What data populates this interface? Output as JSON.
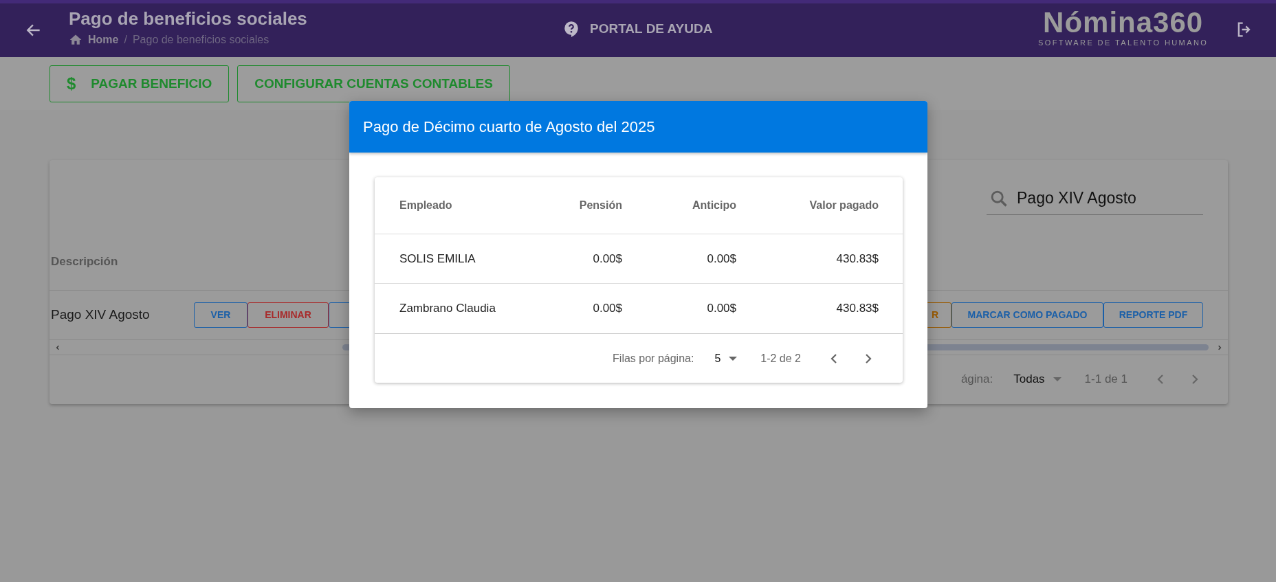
{
  "header": {
    "title": "Pago de beneficios sociales",
    "breadcrumb": [
      {
        "label": "Home",
        "kind": "home"
      },
      {
        "label": "/",
        "kind": "separator"
      },
      {
        "label": "Pago de beneficios sociales",
        "kind": "current"
      }
    ],
    "help_link": "PORTAL DE AYUDA",
    "logo": {
      "name": "Nómina360",
      "tagline": "SOFTWARE DE TALENTO HUMANO"
    }
  },
  "actions": [
    {
      "label": "PAGAR BENEFICIO",
      "kind": "pay",
      "icon": "$"
    },
    {
      "label": "CONFIGURAR CUENTAS CONTABLES",
      "kind": "plain"
    }
  ],
  "benefits_table": {
    "search": {
      "value": "Pago XIV Agosto"
    },
    "columns": [
      "Descripción"
    ],
    "rows": [
      {
        "cells": [
          "Pago XIV Agosto"
        ],
        "buttons": [
          {
            "label": "VER",
            "color": "#1a5fa8",
            "kind": "left"
          },
          {
            "label": "ELIMINAR",
            "color": "#a82a2a",
            "kind": "left"
          },
          {
            "color": "#1a5fa8",
            "kind": "covered"
          },
          {
            "label": "R",
            "color": "#9a5a00",
            "kind": "right"
          },
          {
            "label": "MARCAR COMO PAGADO",
            "color": "#1a5fa8",
            "kind": "right"
          },
          {
            "label": "REPORTE PDF",
            "color": "#1a5fa8",
            "kind": "right"
          }
        ]
      }
    ],
    "footer": {
      "rows_per_page_label": "ágina:",
      "rows_per_page": "Todas",
      "range": "1-1 de 1"
    }
  },
  "modal": {
    "title": "Pago de Décimo cuarto de Agosto del 2025",
    "columns": [
      "Empleado",
      "Pensión",
      "Anticipo",
      "Valor pagado"
    ],
    "rows": [
      [
        "SOLIS EMILIA",
        "0.00$",
        "0.00$",
        "430.83$"
      ],
      [
        "Zambrano Claudia",
        "0.00$",
        "0.00$",
        "430.83$"
      ]
    ],
    "footer": {
      "rows_per_page_label": "Filas por página:",
      "rows_per_page": "5",
      "range": "1-2 de 2"
    }
  }
}
